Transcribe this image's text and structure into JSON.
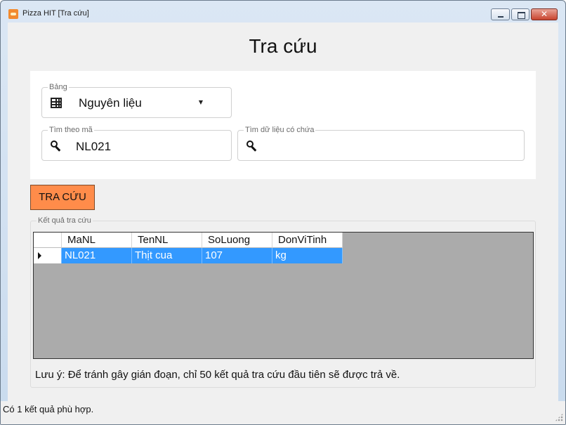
{
  "window": {
    "title": "Pizza HIT [Tra cứu]",
    "close_glyph": "✕"
  },
  "page": {
    "title": "Tra cứu"
  },
  "filters": {
    "table": {
      "label": "Bảng",
      "value": "Nguyên liệu",
      "arrow": "▼"
    },
    "by_id": {
      "label": "Tìm theo mã",
      "value": "NL021"
    },
    "contains": {
      "label": "Tìm dữ liệu có chứa",
      "value": ""
    }
  },
  "search_button": {
    "label": "TRA CỨU"
  },
  "results": {
    "group_label": "Kết quả tra cứu",
    "columns": [
      "MaNL",
      "TenNL",
      "SoLuong",
      "DonViTinh"
    ],
    "rows": [
      [
        "NL021",
        "Thịt cua",
        "107",
        "kg"
      ]
    ],
    "note": "Lưu ý: Để tránh gây gián đoạn, chỉ 50 kết quả tra cứu đầu tiên sẽ được trả về."
  },
  "status": {
    "text": "Có 1 kết quả phù hợp."
  }
}
